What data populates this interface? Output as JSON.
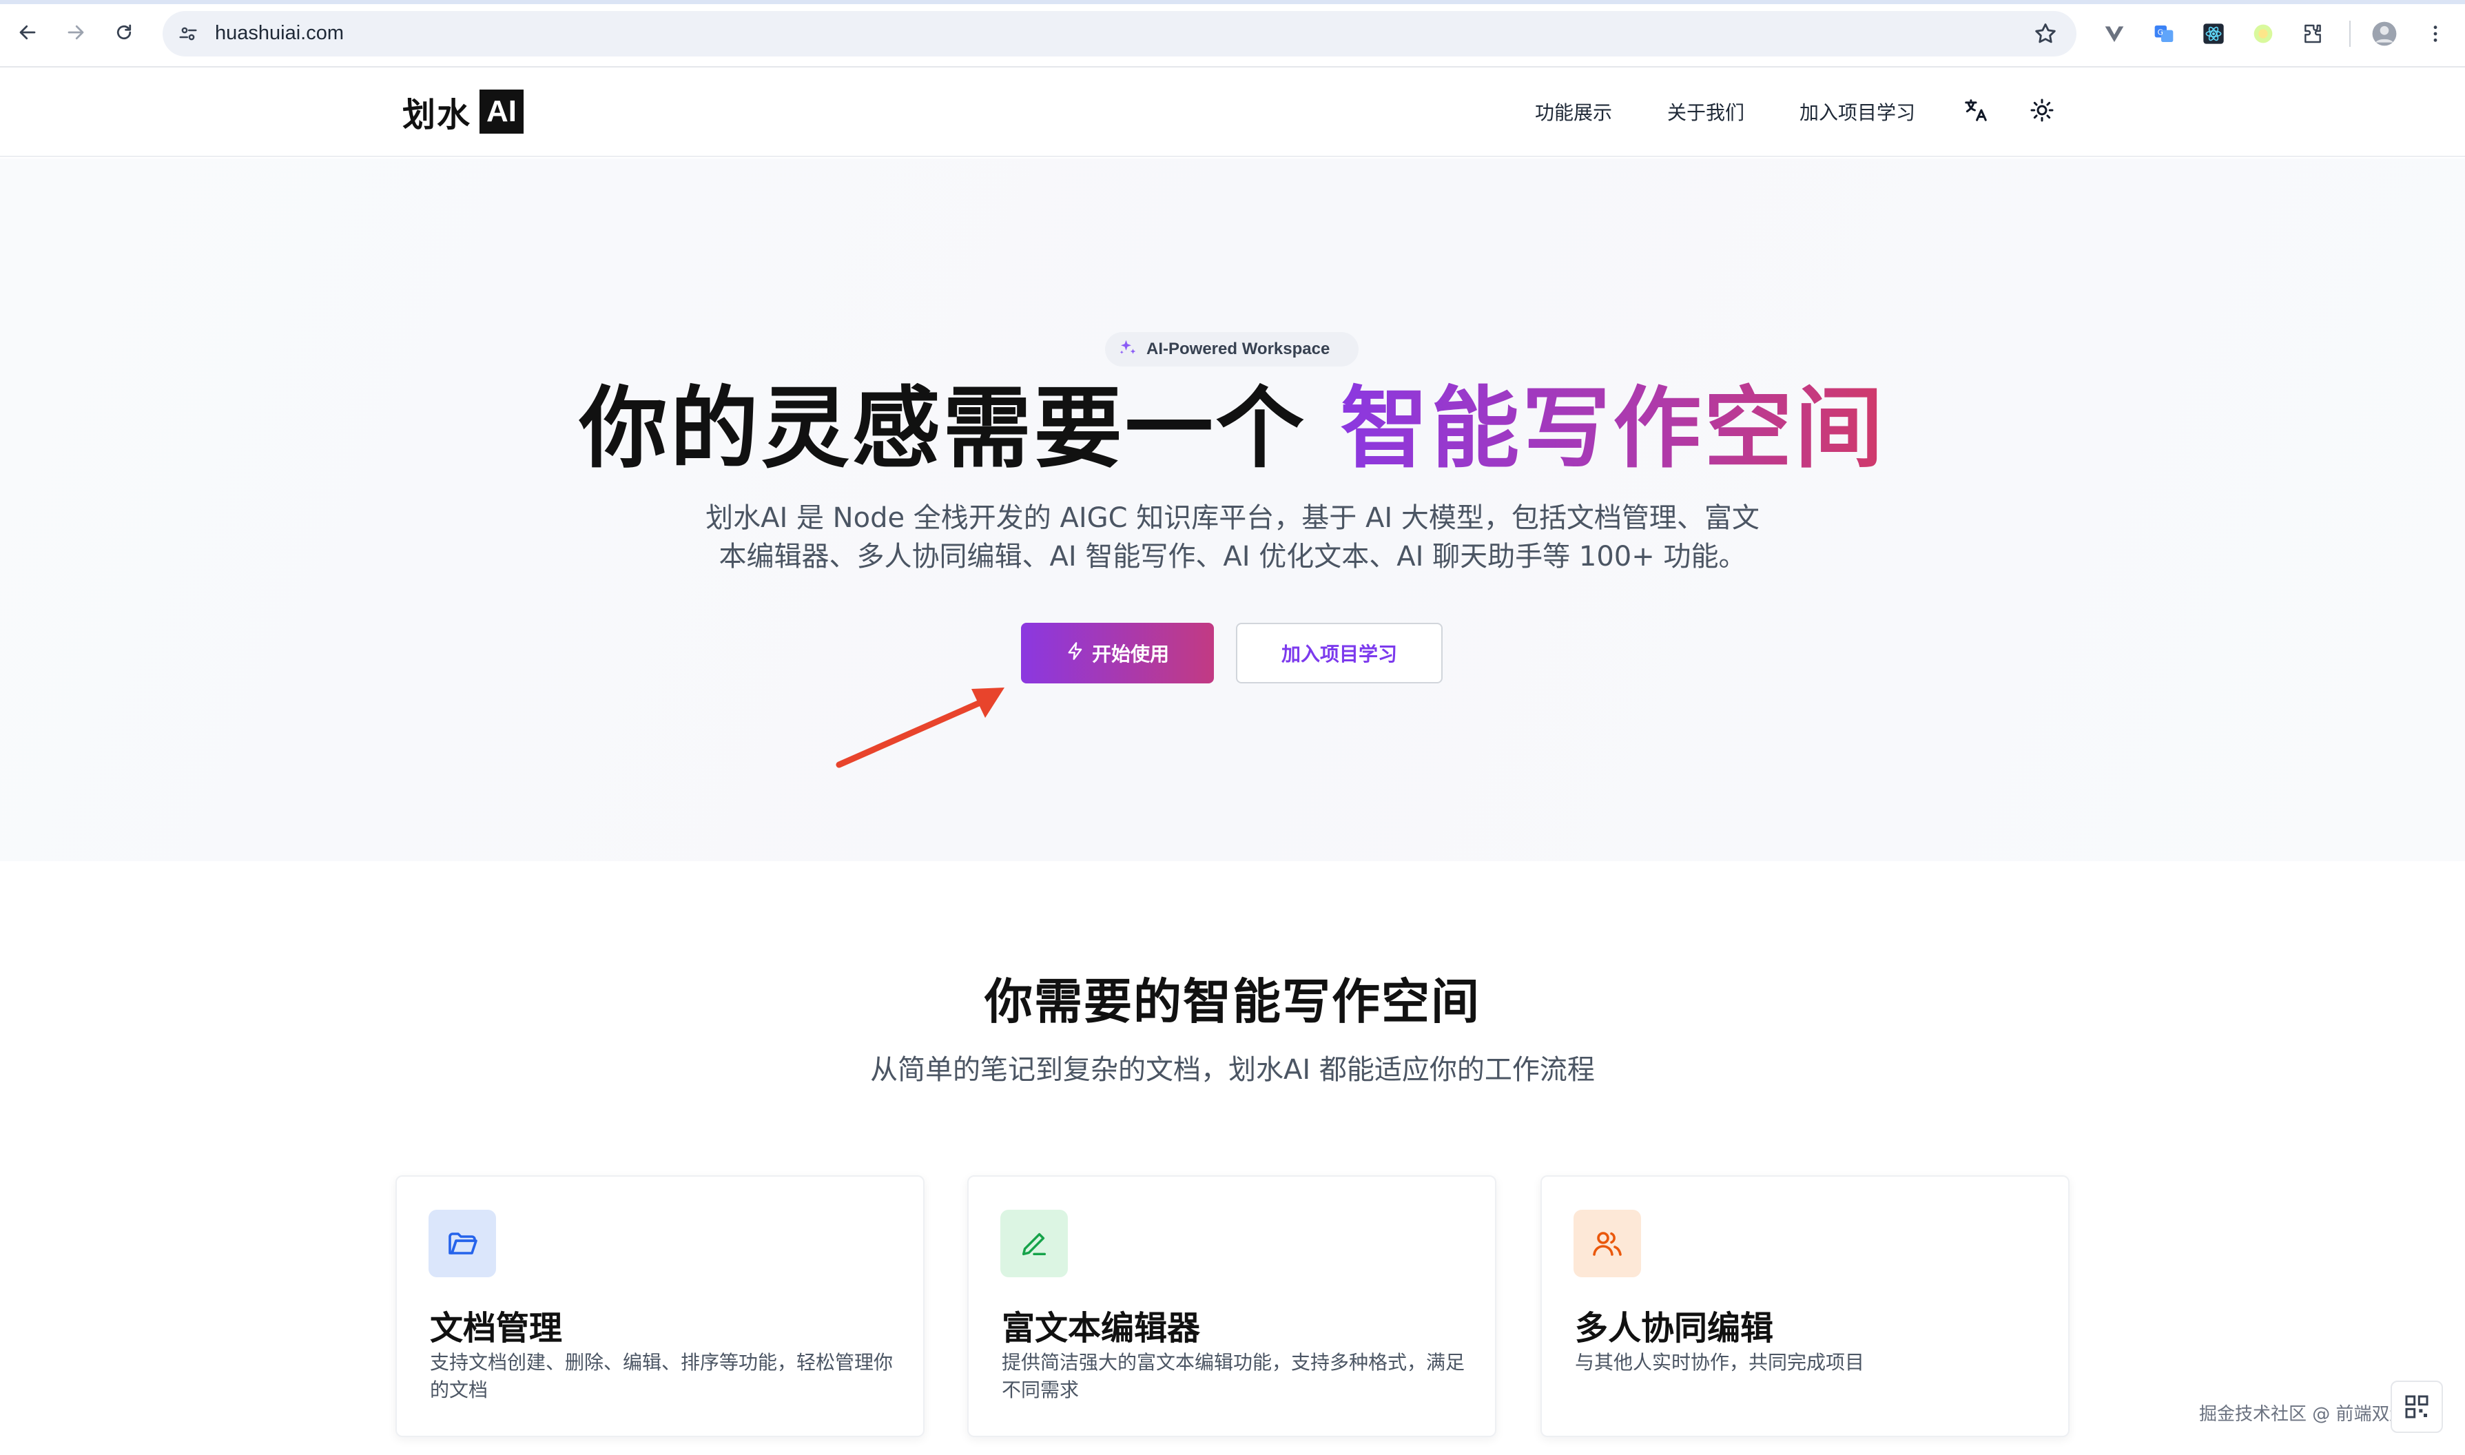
{
  "browser": {
    "url": "huashuiai.com"
  },
  "header": {
    "logo_text": "划水",
    "logo_box": "AI",
    "nav": [
      {
        "label": "功能展示"
      },
      {
        "label": "关于我们"
      },
      {
        "label": "加入项目学习"
      }
    ]
  },
  "hero": {
    "badge": "AI-Powered Workspace",
    "title_plain": "你的灵感需要一个 ",
    "title_gradient": "智能写作空间",
    "desc_line1": "划水AI 是 Node 全栈开发的 AIGC 知识库平台，基于 AI 大模型，包括文档管理、富文",
    "desc_line2": "本编辑器、多人协同编辑、AI 智能写作、AI 优化文本、AI 聊天助手等 100+ 功能。",
    "primary_button": "开始使用",
    "secondary_button": "加入项目学习"
  },
  "features": {
    "title": "你需要的智能写作空间",
    "subtitle": "从简单的笔记到复杂的文档，划水AI 都能适应你的工作流程",
    "cards": [
      {
        "title": "文档管理",
        "desc": "支持文档创建、删除、编辑、排序等功能，轻松管理你的文档",
        "icon": "folder-icon"
      },
      {
        "title": "富文本编辑器",
        "desc": "提供简洁强大的富文本编辑功能，支持多种格式，满足不同需求",
        "icon": "pencil-icon"
      },
      {
        "title": "多人协同编辑",
        "desc": "与其他人实时协作，共同完成项目",
        "icon": "users-icon"
      }
    ]
  },
  "watermark": "掘金技术社区 @ 前端双越老师",
  "colors": {
    "brand_gradient_start": "#8b38e0",
    "brand_gradient_end": "#c23a83",
    "annotation_arrow": "#e8442c"
  }
}
